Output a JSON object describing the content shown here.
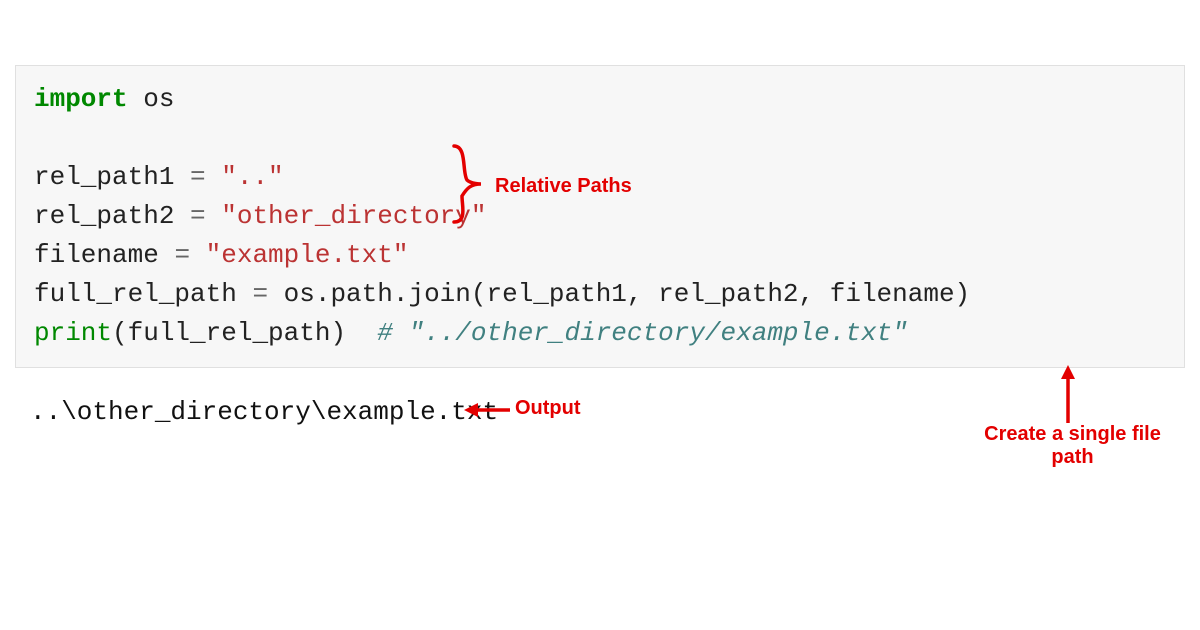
{
  "code": {
    "line1_import": "import",
    "line1_module": " os",
    "line3_var": "rel_path1 ",
    "line3_eq": "=",
    "line3_str": " \"..\"",
    "line4_var": "rel_path2 ",
    "line4_eq": "=",
    "line4_str": " \"other_directory\"",
    "line5_var": "filename ",
    "line5_eq": "=",
    "line5_str": " \"example.txt\"",
    "line6_var": "full_rel_path ",
    "line6_eq": "=",
    "line6_rest": " os.path.join(rel_path1, rel_path2, filename)",
    "line7_print": "print",
    "line7_args": "(full_rel_path)  ",
    "line7_comment": "# \"../other_directory/example.txt\""
  },
  "output": "..\\other_directory\\example.txt",
  "annotations": {
    "relative_paths": "Relative Paths",
    "output_label": "Output",
    "single_file_path": "Create a single file path"
  },
  "colors": {
    "annotation_red": "#e30000",
    "code_bg": "#f7f7f7",
    "kw_green": "#008800",
    "string_red": "#bb3333",
    "comment_teal": "#408080",
    "operator_gray": "#666666"
  }
}
